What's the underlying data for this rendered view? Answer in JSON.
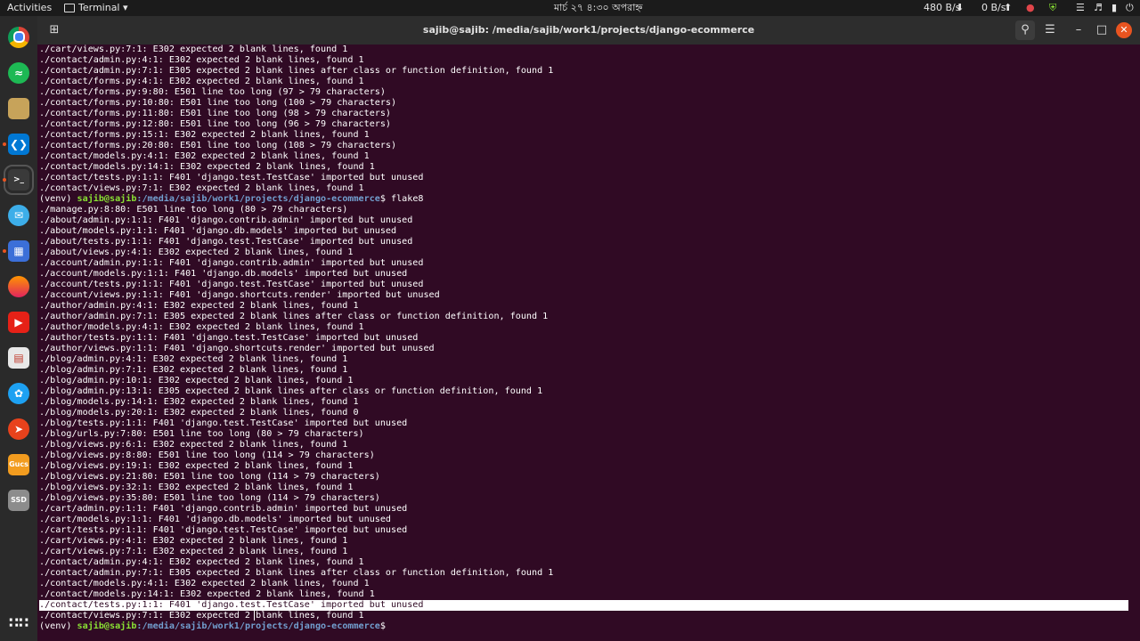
{
  "topbar": {
    "activities": "Activities",
    "app_menu": "Terminal",
    "clock": "মার্চ ২৭  ৪:৩০ অপরাহ্ন",
    "net_down": "480 B/s",
    "net_up": "0 B/s"
  },
  "window": {
    "title": "sajib@sajib: /media/sajib/work1/projects/django-ecommerce"
  },
  "dock": {
    "items": [
      {
        "name": "chrome",
        "label": "",
        "color": "#4285f4"
      },
      {
        "name": "spotify",
        "label": "",
        "color": "#1db954"
      },
      {
        "name": "files",
        "label": "",
        "color": "#c7a35a"
      },
      {
        "name": "vscode",
        "label": "",
        "color": "#0078d4"
      },
      {
        "name": "terminal",
        "label": ">_",
        "color": "#3a3a3a"
      },
      {
        "name": "mail",
        "label": "",
        "color": "#3daee9"
      },
      {
        "name": "screenshot",
        "label": "",
        "color": "#3b6fd8"
      },
      {
        "name": "firefox",
        "label": "",
        "color": "#e66000"
      },
      {
        "name": "youtube",
        "label": "",
        "color": "#e62117"
      },
      {
        "name": "document",
        "label": "",
        "color": "#e8e8e8"
      },
      {
        "name": "twitter",
        "label": "",
        "color": "#1da1f2"
      },
      {
        "name": "compass",
        "label": "",
        "color": "#e8421c"
      },
      {
        "name": "gucs",
        "label": "Gucs",
        "color": "#f29c1f"
      },
      {
        "name": "ssd",
        "label": "SSD",
        "color": "#8c8c8c"
      }
    ]
  },
  "prompt": {
    "venv": "(venv) ",
    "user": "sajib@sajib",
    "path": ":/media/sajib/work1/projects/django-ecommerce",
    "symbol": "$ "
  },
  "command": "flake8",
  "output_before": [
    "./cart/views.py:7:1: E302 expected 2 blank lines, found 1",
    "./contact/admin.py:4:1: E302 expected 2 blank lines, found 1",
    "./contact/admin.py:7:1: E305 expected 2 blank lines after class or function definition, found 1",
    "./contact/forms.py:4:1: E302 expected 2 blank lines, found 1",
    "./contact/forms.py:9:80: E501 line too long (97 > 79 characters)",
    "./contact/forms.py:10:80: E501 line too long (100 > 79 characters)",
    "./contact/forms.py:11:80: E501 line too long (98 > 79 characters)",
    "./contact/forms.py:12:80: E501 line too long (96 > 79 characters)",
    "./contact/forms.py:15:1: E302 expected 2 blank lines, found 1",
    "./contact/forms.py:20:80: E501 line too long (108 > 79 characters)",
    "./contact/models.py:4:1: E302 expected 2 blank lines, found 1",
    "./contact/models.py:14:1: E302 expected 2 blank lines, found 1",
    "./contact/tests.py:1:1: F401 'django.test.TestCase' imported but unused",
    "./contact/views.py:7:1: E302 expected 2 blank lines, found 1"
  ],
  "output_after": [
    "./manage.py:8:80: E501 line too long (80 > 79 characters)",
    "./about/admin.py:1:1: F401 'django.contrib.admin' imported but unused",
    "./about/models.py:1:1: F401 'django.db.models' imported but unused",
    "./about/tests.py:1:1: F401 'django.test.TestCase' imported but unused",
    "./about/views.py:4:1: E302 expected 2 blank lines, found 1",
    "./account/admin.py:1:1: F401 'django.contrib.admin' imported but unused",
    "./account/models.py:1:1: F401 'django.db.models' imported but unused",
    "./account/tests.py:1:1: F401 'django.test.TestCase' imported but unused",
    "./account/views.py:1:1: F401 'django.shortcuts.render' imported but unused",
    "./author/admin.py:4:1: E302 expected 2 blank lines, found 1",
    "./author/admin.py:7:1: E305 expected 2 blank lines after class or function definition, found 1",
    "./author/models.py:4:1: E302 expected 2 blank lines, found 1",
    "./author/tests.py:1:1: F401 'django.test.TestCase' imported but unused",
    "./author/views.py:1:1: F401 'django.shortcuts.render' imported but unused",
    "./blog/admin.py:4:1: E302 expected 2 blank lines, found 1",
    "./blog/admin.py:7:1: E302 expected 2 blank lines, found 1",
    "./blog/admin.py:10:1: E302 expected 2 blank lines, found 1",
    "./blog/admin.py:13:1: E305 expected 2 blank lines after class or function definition, found 1",
    "./blog/models.py:14:1: E302 expected 2 blank lines, found 1",
    "./blog/models.py:20:1: E302 expected 2 blank lines, found 0",
    "./blog/tests.py:1:1: F401 'django.test.TestCase' imported but unused",
    "./blog/urls.py:7:80: E501 line too long (80 > 79 characters)",
    "./blog/views.py:6:1: E302 expected 2 blank lines, found 1",
    "./blog/views.py:8:80: E501 line too long (114 > 79 characters)",
    "./blog/views.py:19:1: E302 expected 2 blank lines, found 1",
    "./blog/views.py:21:80: E501 line too long (114 > 79 characters)",
    "./blog/views.py:32:1: E302 expected 2 blank lines, found 1",
    "./blog/views.py:35:80: E501 line too long (114 > 79 characters)",
    "./cart/admin.py:1:1: F401 'django.contrib.admin' imported but unused",
    "./cart/models.py:1:1: F401 'django.db.models' imported but unused",
    "./cart/tests.py:1:1: F401 'django.test.TestCase' imported but unused",
    "./cart/views.py:4:1: E302 expected 2 blank lines, found 1",
    "./cart/views.py:7:1: E302 expected 2 blank lines, found 1",
    "./contact/admin.py:4:1: E302 expected 2 blank lines, found 1",
    "./contact/admin.py:7:1: E305 expected 2 blank lines after class or function definition, found 1",
    "./contact/models.py:4:1: E302 expected 2 blank lines, found 1",
    "./contact/models.py:14:1: E302 expected 2 blank lines, found 1",
    "./contact/tests.py:1:1: F401 'django.test.TestCase' imported but unused",
    "./contact/views.py:7:1: E302 expected 2 blank lines, found 1"
  ]
}
